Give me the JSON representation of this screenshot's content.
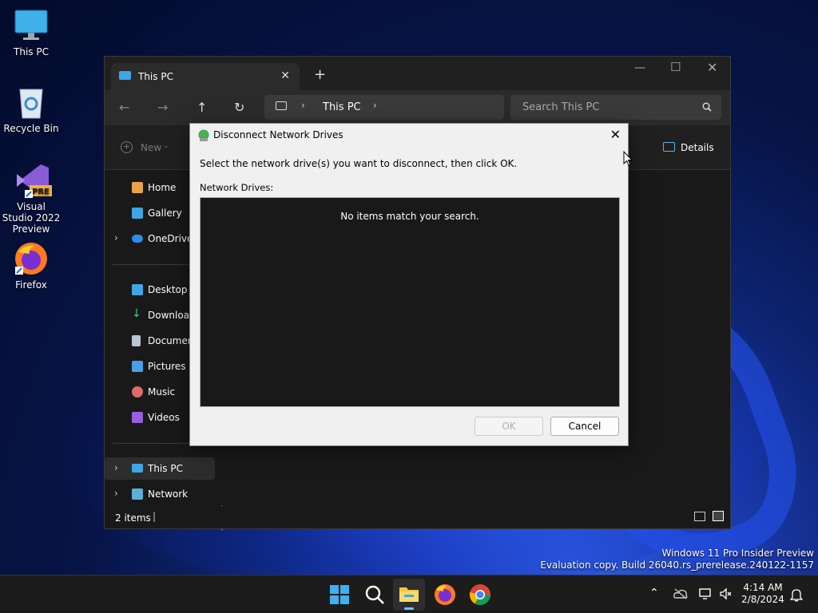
{
  "desktop": {
    "icons": [
      {
        "label": "This PC"
      },
      {
        "label": "Recycle Bin"
      },
      {
        "label": "Visual Studio 2022 Preview",
        "badge": "PRE"
      },
      {
        "label": "Firefox"
      }
    ],
    "watermark": {
      "line1": "Windows 11 Pro Insider Preview",
      "line2": "Evaluation copy. Build 26040.rs_prerelease.240122-1157"
    }
  },
  "explorer": {
    "tab_title": "This PC",
    "address": "This PC",
    "search_placeholder": "Search This PC",
    "new_label": "New",
    "details_label": "Details",
    "status_count": "2 items",
    "sidebar": [
      {
        "label": "Home",
        "icon": "home-icon"
      },
      {
        "label": "Gallery",
        "icon": "gallery-icon"
      },
      {
        "label": "OneDrive",
        "icon": "onedrive-icon"
      },
      {
        "label": "Desktop",
        "icon": "desktop-icon"
      },
      {
        "label": "Download",
        "icon": "downloads-icon"
      },
      {
        "label": "Documen",
        "icon": "documents-icon"
      },
      {
        "label": "Pictures",
        "icon": "pictures-icon"
      },
      {
        "label": "Music",
        "icon": "music-icon"
      },
      {
        "label": "Videos",
        "icon": "videos-icon"
      },
      {
        "label": "This PC",
        "icon": "this-pc-icon"
      },
      {
        "label": "Network",
        "icon": "network-icon"
      }
    ]
  },
  "dialog": {
    "title": "Disconnect Network Drives",
    "instruction": "Select the network drive(s) you want to disconnect, then click OK.",
    "list_label": "Network Drives:",
    "empty_message": "No items match your search.",
    "ok_label": "OK",
    "cancel_label": "Cancel"
  },
  "taskbar": {
    "time": "4:14 AM",
    "date": "2/8/2024"
  },
  "colors": {
    "accent": "#3fa6e6",
    "dialog_bg": "#f0f0f0",
    "dark_bg": "#191919"
  }
}
